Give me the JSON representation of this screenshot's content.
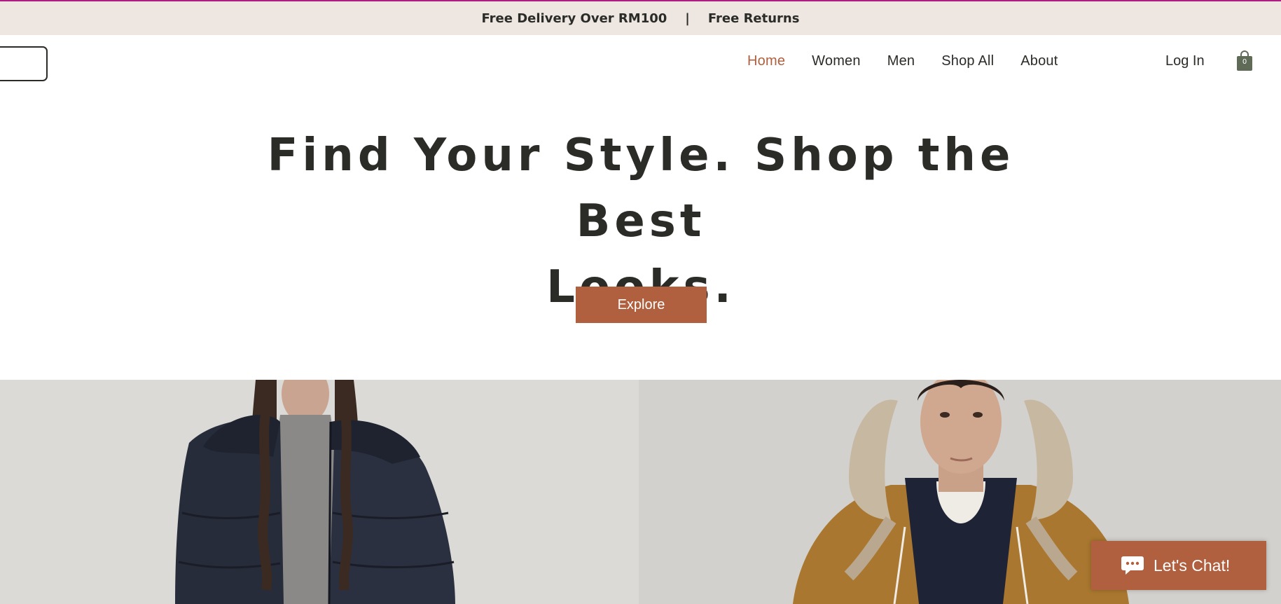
{
  "announcement": {
    "left": "Free Delivery Over RM100",
    "separator": "|",
    "right": "Free Returns"
  },
  "nav": {
    "items": [
      {
        "label": "Home",
        "active": true
      },
      {
        "label": "Women",
        "active": false
      },
      {
        "label": "Men",
        "active": false
      },
      {
        "label": "Shop All",
        "active": false
      },
      {
        "label": "About",
        "active": false
      }
    ],
    "login": "Log In",
    "cart_count": "0"
  },
  "hero": {
    "title_line1": "Find Your Style. Shop the Best",
    "title_line2": "Looks.",
    "button": "Explore"
  },
  "panels": {
    "left": {
      "image": "woman-in-navy-puffer-jacket"
    },
    "right": {
      "image": "man-in-fur-hood-parka"
    }
  },
  "chat": {
    "label": "Let's Chat!",
    "icon": "chat-bubble-icon"
  },
  "colors": {
    "accent": "#b05f3f",
    "announcement_bg": "#ede6e1",
    "text": "#2b2c27",
    "cart_icon": "#5f6b57"
  }
}
